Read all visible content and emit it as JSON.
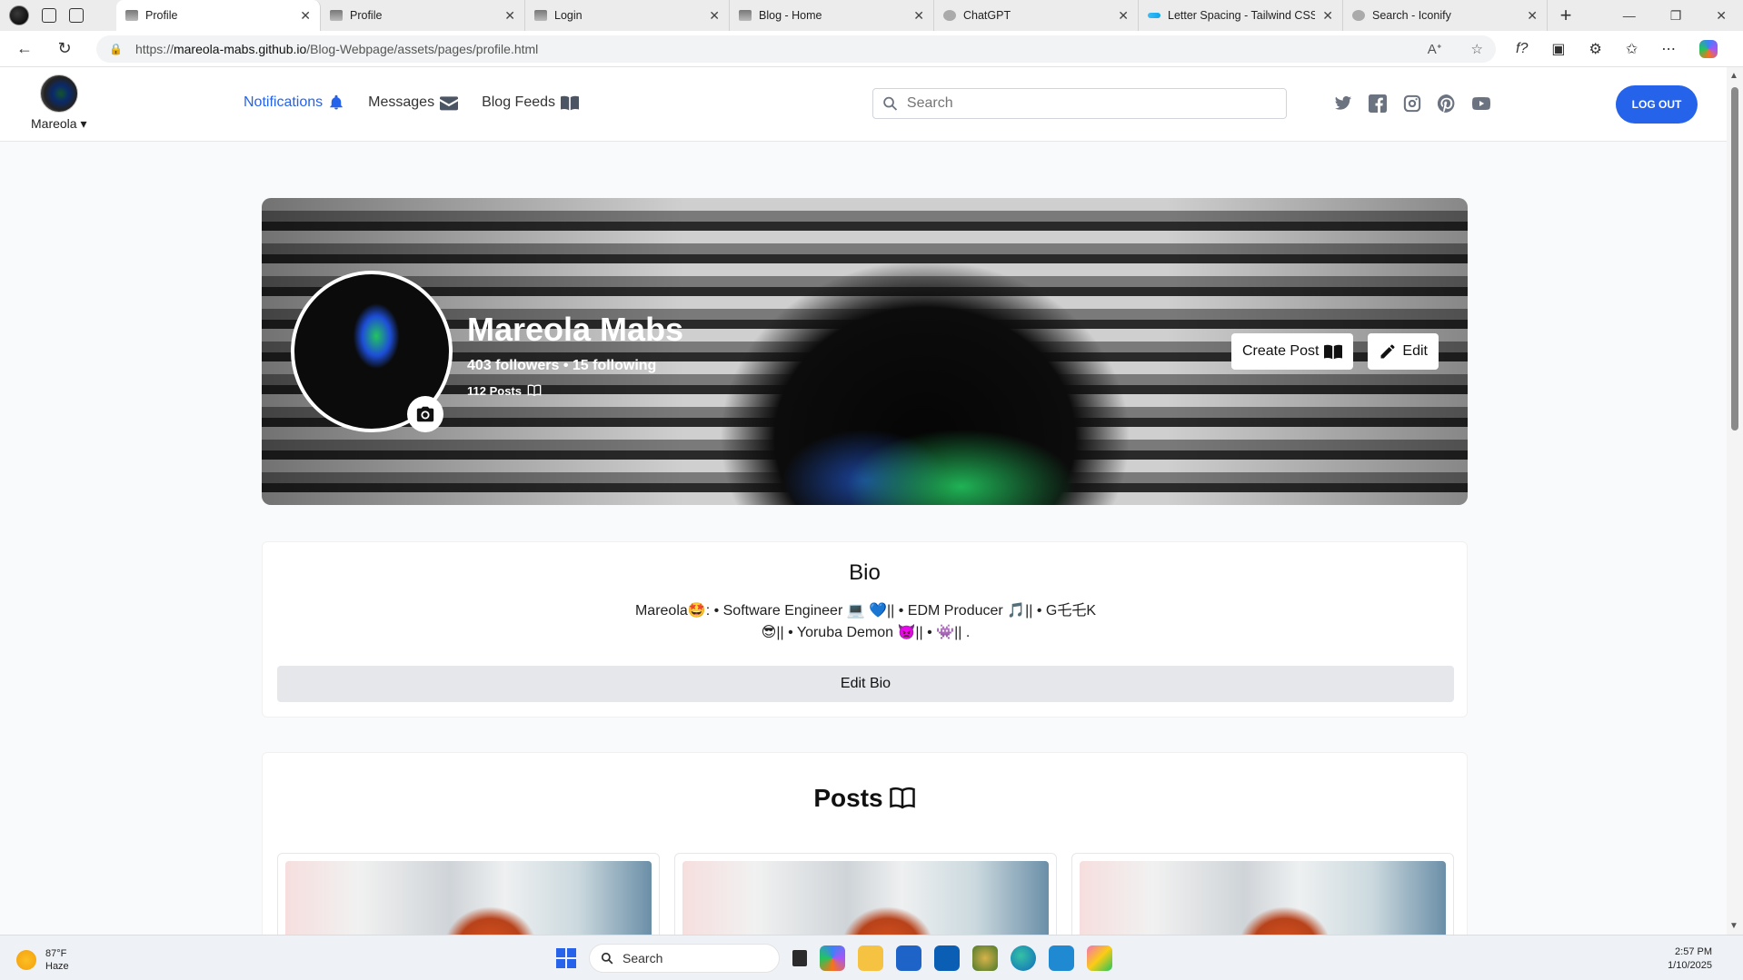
{
  "browser": {
    "tabs": [
      {
        "title": "Profile",
        "active": true
      },
      {
        "title": "Profile",
        "active": false
      },
      {
        "title": "Login",
        "active": false
      },
      {
        "title": "Blog - Home",
        "active": false
      },
      {
        "title": "ChatGPT",
        "active": false
      },
      {
        "title": "Letter Spacing - Tailwind CSS",
        "active": false
      },
      {
        "title": "Search - Iconify",
        "active": false
      }
    ],
    "url_prefix": "https://",
    "url_host": "mareola-mabs.github.io",
    "url_path": "/Blog-Webpage/assets/pages/profile.html"
  },
  "header": {
    "user_name": "Mareola",
    "nav": [
      {
        "label": "Notifications",
        "icon": "bell-icon",
        "active": true
      },
      {
        "label": "Messages",
        "icon": "envelope-icon",
        "active": false
      },
      {
        "label": "Blog Feeds",
        "icon": "book-icon",
        "active": false
      }
    ],
    "search_placeholder": "Search",
    "social_icons": [
      "twitter-icon",
      "facebook-icon",
      "instagram-icon",
      "pinterest-icon",
      "youtube-icon"
    ],
    "logout_label": "LOG OUT",
    "accent_color": "#2563eb"
  },
  "profile": {
    "name": "Mareola Mabs",
    "followers_text": "403 followers",
    "separator": " • ",
    "following_text": "15 following",
    "posts_text": "112 Posts",
    "create_post_label": "Create Post",
    "edit_label": "Edit"
  },
  "bio": {
    "title": "Bio",
    "line1": "Mareola🤩: • Software Engineer 💻 💙|| • EDM Producer 🎵|| • G乇乇K",
    "line2": "😎|| • Yoruba Demon 👿|| • 👾|| .",
    "edit_label": "Edit Bio"
  },
  "posts": {
    "title": "Posts",
    "cards": [
      {
        "id": 1
      },
      {
        "id": 2
      },
      {
        "id": 3
      }
    ]
  },
  "taskbar": {
    "temp": "87°F",
    "condition": "Haze",
    "search_label": "Search",
    "time": "2:57 PM",
    "date": "1/10/2025"
  }
}
